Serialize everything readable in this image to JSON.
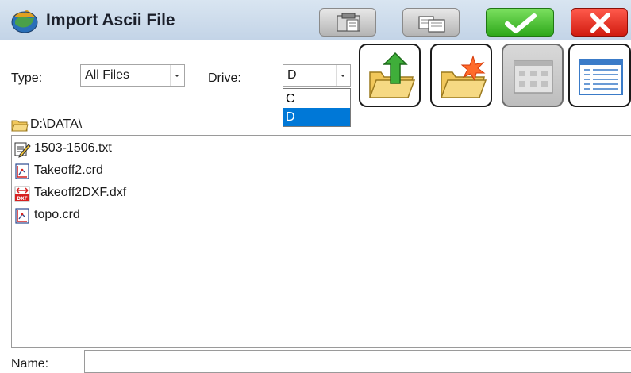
{
  "window": {
    "title": "Import Ascii File",
    "icon": "globe-gear-icon"
  },
  "titlebar_buttons": [
    {
      "name": "paste-button",
      "icon": "clipboard-icon"
    },
    {
      "name": "copy-button",
      "icon": "copy-icon"
    },
    {
      "name": "ok-button",
      "icon": "checkmark-icon",
      "color": "#2ea81b"
    },
    {
      "name": "close-button",
      "icon": "close-icon",
      "color": "#d11c10"
    }
  ],
  "filters": {
    "type_label": "Type:",
    "type_value": "All Files",
    "drive_label": "Drive:",
    "drive_value": "D",
    "drive_options": [
      "C",
      "D"
    ],
    "drive_selected": "D"
  },
  "actions": [
    {
      "name": "up-folder-button",
      "icon": "folder-up-icon"
    },
    {
      "name": "new-folder-button",
      "icon": "new-folder-icon"
    },
    {
      "name": "icon-view-button",
      "icon": "icon-grid-icon",
      "disabled": true
    },
    {
      "name": "list-view-button",
      "icon": "list-view-icon"
    }
  ],
  "path": "D:\\DATA\\",
  "files": [
    {
      "name": "1503-1506.txt",
      "icon": "text-file-icon"
    },
    {
      "name": "Takeoff2.crd",
      "icon": "crd-file-icon"
    },
    {
      "name": "Takeoff2DXF.dxf",
      "icon": "dxf-file-icon"
    },
    {
      "name": "topo.crd",
      "icon": "crd-file-icon"
    }
  ],
  "name_field": {
    "label": "Name:",
    "value": ""
  },
  "colors": {
    "titlebar": "#c3d4e7",
    "selection": "#0078d7",
    "ok": "#2ea81b",
    "close": "#d11c10"
  }
}
